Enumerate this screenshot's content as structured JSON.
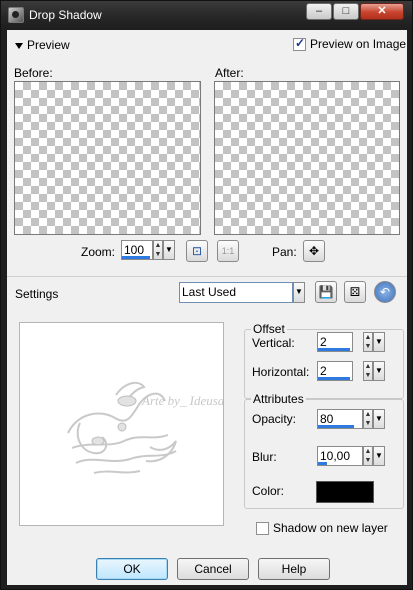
{
  "window": {
    "title": "Drop Shadow",
    "min": "–",
    "max": "□",
    "close": "✕"
  },
  "preview": {
    "toggle_label": "Preview",
    "preview_on_image_label": "Preview on Image",
    "preview_on_image_checked": true,
    "before_label": "Before:",
    "after_label": "After:"
  },
  "zoom": {
    "label": "Zoom:",
    "value": "100",
    "fit_icon": "⊡",
    "actual_icon": "1:1"
  },
  "pan": {
    "label": "Pan:",
    "icon": "✥"
  },
  "settings": {
    "label": "Settings",
    "preset": "Last Used"
  },
  "watermark_text": "Arte by_ Ideusa Nunes",
  "offset": {
    "title": "Offset",
    "vertical_label": "Vertical:",
    "vertical_value": "2",
    "horizontal_label": "Horizontal:",
    "horizontal_value": "2"
  },
  "attributes": {
    "title": "Attributes",
    "opacity_label": "Opacity:",
    "opacity_value": "80",
    "blur_label": "Blur:",
    "blur_value": "10,00",
    "color_label": "Color:",
    "color_value": "#000000"
  },
  "shadow_new_layer": {
    "label": "Shadow on new layer",
    "checked": false
  },
  "buttons": {
    "ok": "OK",
    "cancel": "Cancel",
    "help": "Help"
  }
}
